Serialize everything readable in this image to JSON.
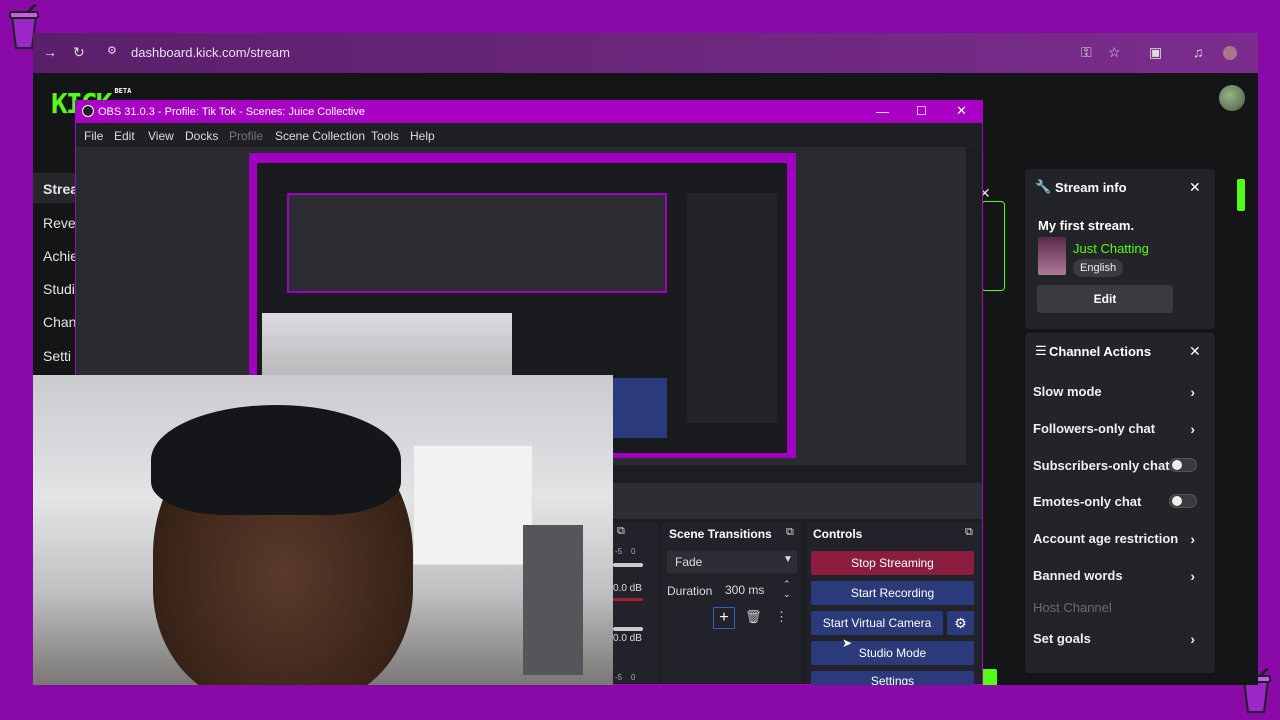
{
  "browser": {
    "url": "dashboard.kick.com/stream"
  },
  "kick": {
    "logo_text": "KICK",
    "logo_badge": "BETA",
    "nav": [
      "Strea",
      "Reve",
      "Achie",
      "Studi",
      "Chan",
      "Setti"
    ],
    "stream_info": {
      "title": "Stream info",
      "stream_title": "My first stream.",
      "category": "Just Chatting",
      "language": "English",
      "edit_label": "Edit"
    },
    "channel_actions": {
      "title": "Channel Actions",
      "items": [
        {
          "label": "Slow mode",
          "control": "chevron"
        },
        {
          "label": "Followers-only chat",
          "control": "chevron"
        },
        {
          "label": "Subscribers-only chat",
          "control": "toggle"
        },
        {
          "label": "Emotes-only chat",
          "control": "toggle"
        },
        {
          "label": "Account age restriction",
          "control": "chevron"
        },
        {
          "label": "Banned words",
          "control": "chevron"
        },
        {
          "label": "Host Channel",
          "control": "none"
        },
        {
          "label": "Set goals",
          "control": "chevron"
        }
      ]
    },
    "accent_color": "#53fc18"
  },
  "obs": {
    "title": "OBS 31.0.3 - Profile: Tik Tok - Scenes: Juice Collective",
    "menu": [
      "File",
      "Edit",
      "View",
      "Docks",
      "Profile",
      "Scene Collection",
      "Tools",
      "Help"
    ],
    "scene_transitions": {
      "title": "Scene Transitions",
      "transition": "Fade",
      "duration_label": "Duration",
      "duration_value": "300 ms"
    },
    "controls": {
      "title": "Controls",
      "buttons": [
        "Stop Streaming",
        "Start Recording",
        "Start Virtual Camera",
        "Studio Mode",
        "Settings"
      ]
    },
    "audio": {
      "levels": [
        "-5",
        "0",
        "0.0 dB",
        "0.0 dB",
        "-5",
        "0"
      ]
    },
    "accent_color": "#a800c4"
  }
}
